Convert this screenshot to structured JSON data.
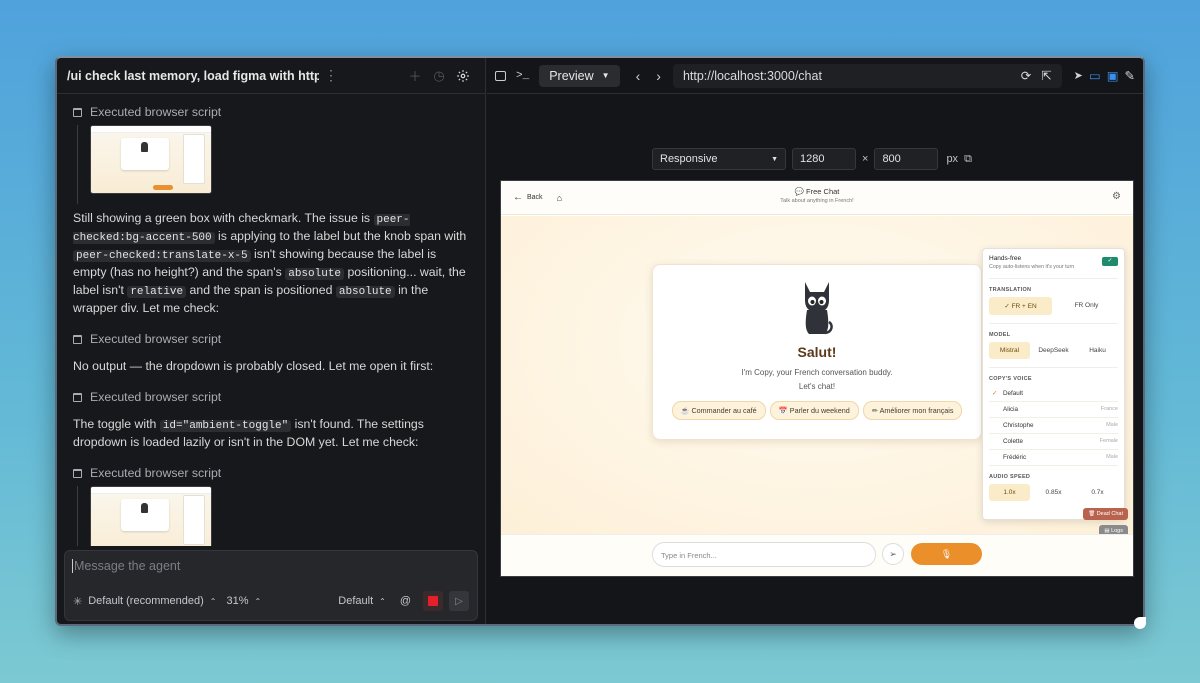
{
  "left": {
    "title": "/ui check last memory, load figma with https://...",
    "exec_label": "Executed browser script",
    "para1": {
      "t1": "Still showing a green box with checkmark. The issue is ",
      "c1": "peer-checked:bg-accent-500",
      "t2": " is applying to the label but the knob span with ",
      "c2": "peer-checked:translate-x-5",
      "t3": " isn't showing because the label is empty (has no height?) and the span's ",
      "c3": "absolute",
      "t4": " positioning... wait, the label isn't ",
      "c4": "relative",
      "t5": " and the span is positioned ",
      "c5": "absolute",
      "t6": " in the wrapper div. Let me check:"
    },
    "para2": "No output — the dropdown is probably closed. Let me open it first:",
    "para3": {
      "t1": "The toggle with ",
      "c1": "id=\"ambient-toggle\"",
      "t2": " isn't found. The settings dropdown is loaded lazily or isn't in the DOM yet. Let me check:"
    },
    "ellipsis": "•••",
    "composer": {
      "placeholder": "Message the agent",
      "model": "Default (recommended)",
      "percent": "31%",
      "mode": "Default",
      "at": "@"
    }
  },
  "right": {
    "tab": "Preview",
    "url": "http://localhost:3000/chat",
    "viewport": {
      "preset": "Responsive",
      "width": "1280",
      "times": "×",
      "height": "800",
      "unit": "px"
    },
    "site": {
      "back": "Back",
      "title": "Free Chat",
      "subtitle": "Talk about anything in French!",
      "greeting": "Salut!",
      "intro1": "I'm Copy, your French conversation buddy.",
      "intro2": "Let's chat!",
      "chips": [
        "Commander au café",
        "Parler du weekend",
        "Améliorer mon français"
      ],
      "input_placeholder": "Type in French...",
      "dead_chat": "Dead Chat",
      "logs": "Logs",
      "panel": {
        "handsfree": "Hands-free",
        "handsfree_sub": "Copy auto-listens when it's your turn",
        "translation_label": "TRANSLATION",
        "translation_opts": [
          "✓ FR + EN",
          "FR Only"
        ],
        "model_label": "MODEL",
        "model_opts": [
          "Mistral",
          "DeepSeek",
          "Haiku"
        ],
        "voice_label": "COPY'S VOICE",
        "voices": [
          {
            "name": "Default",
            "tag": ""
          },
          {
            "name": "Alicia",
            "tag": "France"
          },
          {
            "name": "Christophe",
            "tag": "Male"
          },
          {
            "name": "Colette",
            "tag": "Female"
          },
          {
            "name": "Frédéric",
            "tag": "Male"
          }
        ],
        "speed_label": "AUDIO SPEED",
        "speed_opts": [
          "1.0x",
          "0.85x",
          "0.7x"
        ]
      }
    }
  }
}
